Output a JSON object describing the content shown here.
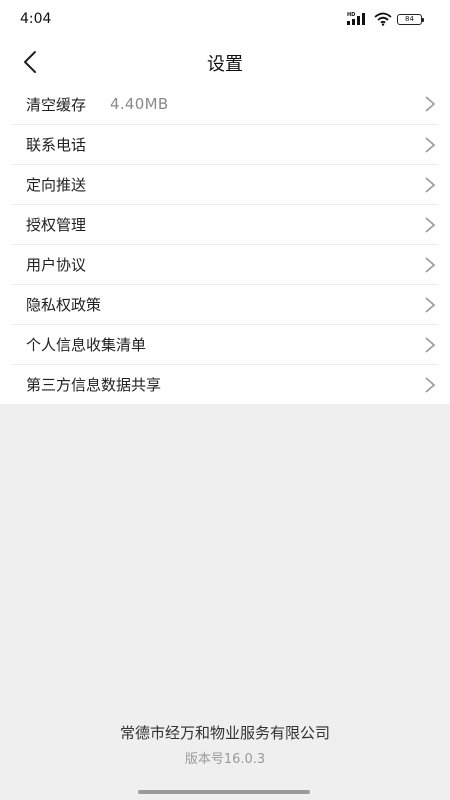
{
  "status_bar": {
    "time": "4:04",
    "network_label": "HD",
    "battery": "84"
  },
  "header": {
    "title": "设置"
  },
  "settings": {
    "items": [
      {
        "label": "清空缓存",
        "value": "4.40MB"
      },
      {
        "label": "联系电话"
      },
      {
        "label": "定向推送"
      },
      {
        "label": "授权管理"
      },
      {
        "label": "用户协议"
      },
      {
        "label": "隐私权政策"
      },
      {
        "label": "个人信息收集清单"
      },
      {
        "label": "第三方信息数据共享"
      }
    ]
  },
  "footer": {
    "company": "常德市经万和物业服务有限公司",
    "version": "版本号16.0.3"
  },
  "icons": {
    "back": "chevron-left-icon",
    "row_arrow": "chevron-right-icon"
  },
  "colors": {
    "page_background": "#efefef",
    "card_background": "#ffffff",
    "muted_text": "#8a8a8a"
  }
}
